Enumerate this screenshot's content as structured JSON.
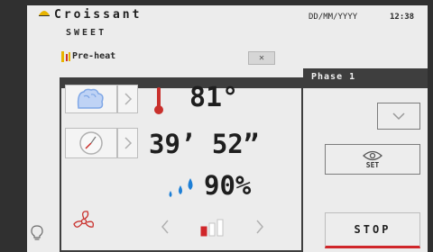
{
  "header": {
    "program_name": "Croissant",
    "program_category": "SWEET",
    "date": "DD/MM/YYYY",
    "time": "12:38"
  },
  "preheat": {
    "label": "Pre-heat",
    "close_label": "✕"
  },
  "phase": {
    "label": "Phase 1"
  },
  "readings": {
    "temperature": "81°",
    "time": "39’ 52”",
    "humidity": "90%"
  },
  "fan": {
    "level_fraction": 0.33
  },
  "controls": {
    "set_label": "SET",
    "stop_label": "STOP"
  },
  "colors": {
    "accent_red": "#d0262a",
    "humidity_blue": "#1d7fd6",
    "steam_blue": "#7fa7e6",
    "thermo_red": "#c9302c",
    "yellow": "#e8b400"
  },
  "icons": [
    "croissant-icon",
    "preheat-icon",
    "steam-icon",
    "thermometer-icon",
    "clock-icon",
    "water-drops-icon",
    "fan-icon",
    "eye-icon",
    "chevron-down-icon",
    "light-bulb-icon"
  ]
}
